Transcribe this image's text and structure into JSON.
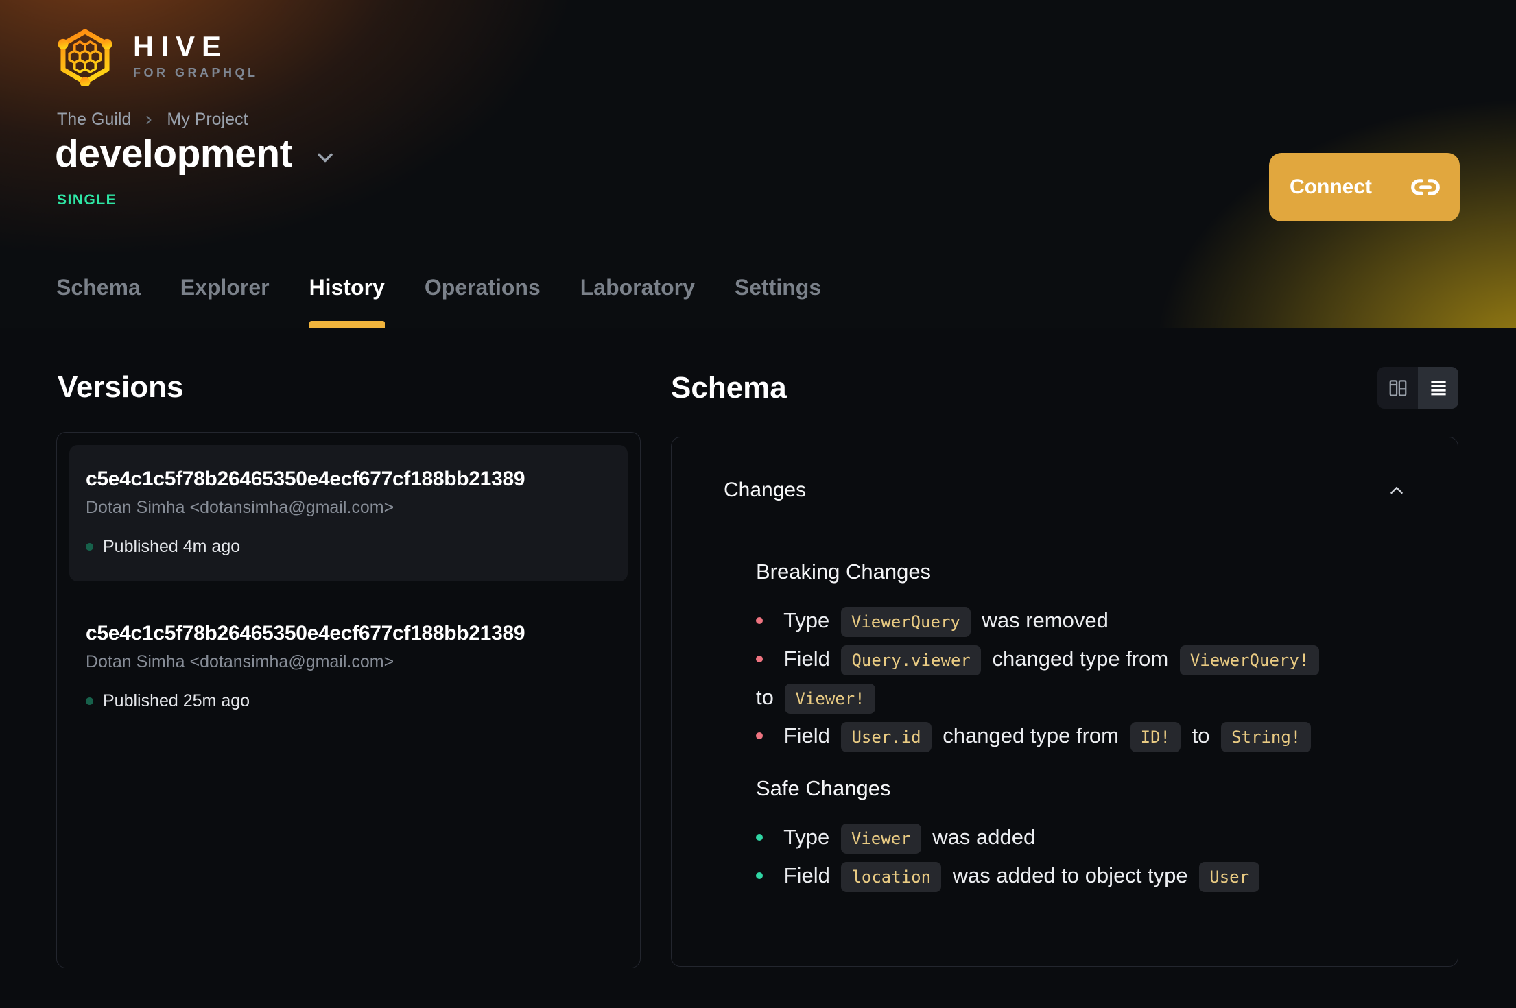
{
  "brand": {
    "name": "HIVE",
    "tagline": "FOR GRAPHQL"
  },
  "breadcrumb": {
    "org": "The Guild",
    "project": "My Project"
  },
  "project": {
    "name": "development",
    "badge": "SINGLE"
  },
  "actions": {
    "connect_label": "Connect"
  },
  "tabs": {
    "items": [
      {
        "label": "Schema",
        "active": false
      },
      {
        "label": "Explorer",
        "active": false
      },
      {
        "label": "History",
        "active": true
      },
      {
        "label": "Operations",
        "active": false
      },
      {
        "label": "Laboratory",
        "active": false
      },
      {
        "label": "Settings",
        "active": false
      }
    ]
  },
  "versions": {
    "title": "Versions",
    "items": [
      {
        "hash": "c5e4c1c5f78b26465350e4ecf677cf188bb21389",
        "author": "Dotan Simha <dotansimha@gmail.com>",
        "status": "Published 4m ago"
      },
      {
        "hash": "c5e4c1c5f78b26465350e4ecf677cf188bb21389",
        "author": "Dotan Simha <dotansimha@gmail.com>",
        "status": "Published 25m ago"
      }
    ]
  },
  "schema": {
    "title": "Schema",
    "panel_title": "Changes",
    "breaking": {
      "title": "Breaking Changes",
      "items": [
        {
          "t1": "Type",
          "c1": "ViewerQuery",
          "t2": "was removed"
        },
        {
          "t1": "Field",
          "c1": "Query.viewer",
          "t2": "changed type from",
          "c2": "ViewerQuery!",
          "t3": "to",
          "c3": "Viewer!"
        },
        {
          "t1": "Field",
          "c1": "User.id",
          "t2": "changed type from",
          "c2": "ID!",
          "t3": "to",
          "c3": "String!"
        }
      ]
    },
    "safe": {
      "title": "Safe Changes",
      "items": [
        {
          "t1": "Type",
          "c1": "Viewer",
          "t2": "was added"
        },
        {
          "t1": "Field",
          "c1": "location",
          "t2": "was added to object type",
          "c2": "User"
        }
      ]
    }
  },
  "icons": {
    "logo": "hive-honeycomb-hexagon",
    "connect": "link-icon",
    "view_left": "columns-diff-icon",
    "view_right": "list-icon"
  },
  "colors": {
    "accent_tab_underline": "#f1b43c",
    "connect_button": "#e1a73e",
    "badge_green": "#2ee5a4",
    "published_dot": "#35dfa6",
    "breaking_bullet": "#ee7480",
    "safe_bullet": "#30d6a4",
    "chip_text": "#e9cb83",
    "chip_bg": "#26282d",
    "card_bg": "#16181d",
    "page_bg": "#0a0c0f"
  }
}
